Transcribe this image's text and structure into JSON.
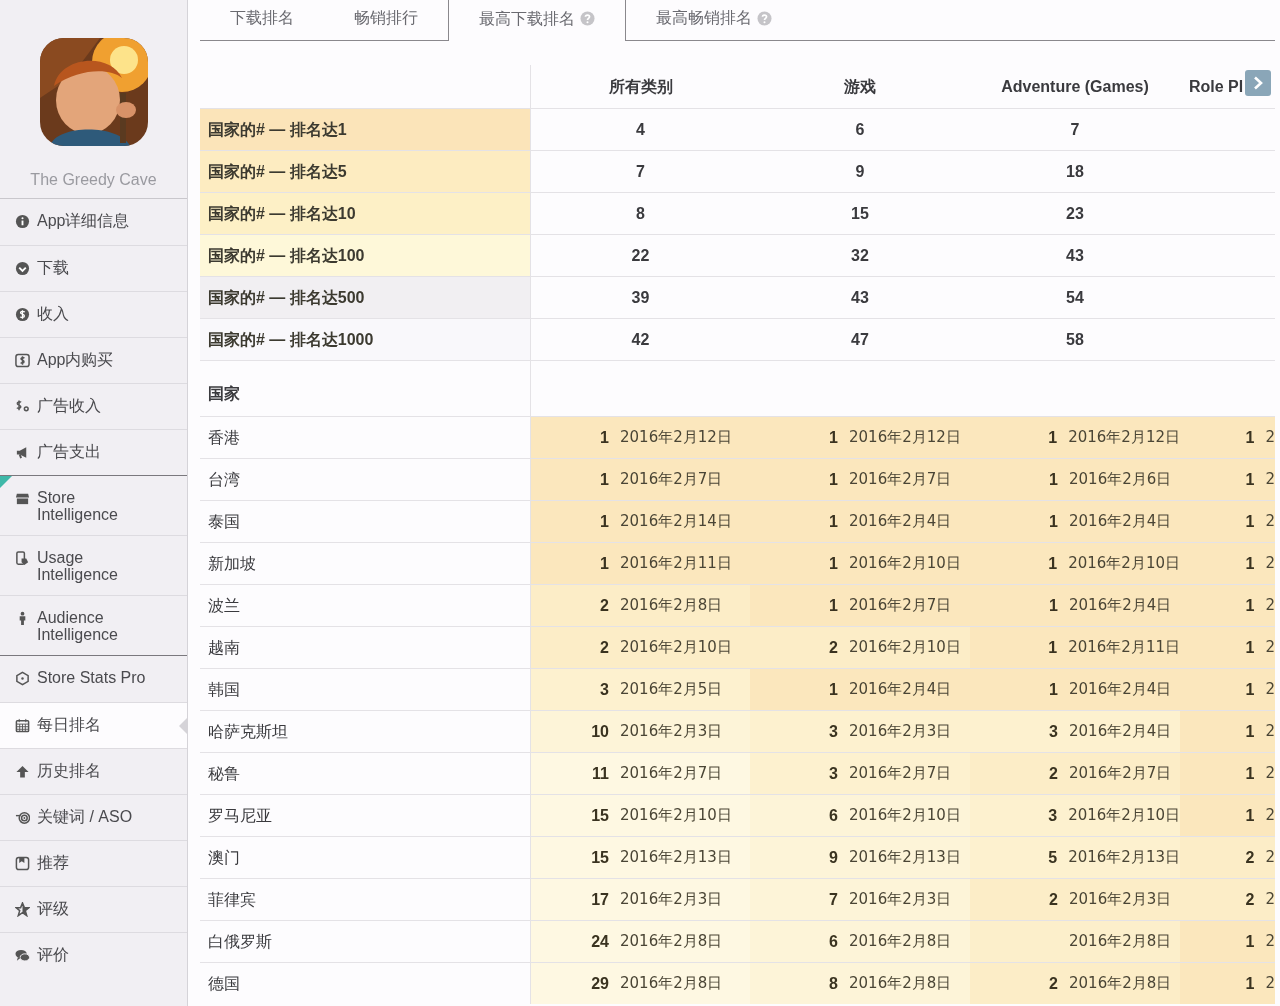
{
  "sidebar": {
    "app": {
      "name": "The Greedy Cave"
    },
    "groups": [
      [
        {
          "label": "App详细信息",
          "selected": false
        },
        {
          "label": "下载",
          "selected": false
        },
        {
          "label": "收入",
          "selected": false
        },
        {
          "label": "App内购买",
          "selected": false
        },
        {
          "label": "广告收入",
          "selected": false
        },
        {
          "label": "广告支出",
          "selected": false
        }
      ],
      [
        {
          "label": "Store Intelligence",
          "selected": false
        },
        {
          "label": "Usage Intelligence",
          "selected": false
        },
        {
          "label": "Audience Intelligence",
          "selected": false
        }
      ],
      [
        {
          "label": "Store Stats Pro",
          "selected": false
        },
        {
          "label": "每日排名",
          "selected": true
        },
        {
          "label": "历史排名",
          "selected": false
        },
        {
          "label": "关键词 / ASO",
          "selected": false
        },
        {
          "label": "推荐",
          "selected": false
        },
        {
          "label": "评级",
          "selected": false
        },
        {
          "label": "评价",
          "selected": false
        }
      ]
    ]
  },
  "tabs": [
    {
      "label": "下载排名",
      "selected": false,
      "help": false
    },
    {
      "label": "畅销排行",
      "selected": false,
      "help": false
    },
    {
      "label": "最高下载排名",
      "selected": true,
      "help": true
    },
    {
      "label": "最高畅销排名",
      "selected": false,
      "help": true
    }
  ],
  "table": {
    "columns": [
      "所有类别",
      "游戏",
      "Adventure (Games)",
      "Role Pl"
    ],
    "summary_rows": [
      {
        "label": "国家的# — 排名达1",
        "color": "#fbe4b9",
        "values": [
          "4",
          "6",
          "7"
        ]
      },
      {
        "label": "国家的# — 排名达5",
        "color": "#fdecc1",
        "values": [
          "7",
          "9",
          "18"
        ]
      },
      {
        "label": "国家的# — 排名达10",
        "color": "#fdf0c6",
        "values": [
          "8",
          "15",
          "23"
        ]
      },
      {
        "label": "国家的# — 排名达100",
        "color": "#fef8d9",
        "values": [
          "22",
          "32",
          "43"
        ]
      },
      {
        "label": "国家的# — 排名达500",
        "color": "#f1eff2",
        "values": [
          "39",
          "43",
          "54"
        ]
      },
      {
        "label": "国家的# — 排名达1000",
        "color": "#f9f8fb",
        "values": [
          "42",
          "47",
          "58"
        ]
      }
    ],
    "section_title": "国家",
    "country_rows": [
      {
        "country": "香港",
        "cells": [
          {
            "rank": "1",
            "date": "2016年2月12日"
          },
          {
            "rank": "1",
            "date": "2016年2月12日"
          },
          {
            "rank": "1",
            "date": "2016年2月12日"
          },
          {
            "rank": "1",
            "date": "2"
          }
        ]
      },
      {
        "country": "台湾",
        "cells": [
          {
            "rank": "1",
            "date": "2016年2月7日"
          },
          {
            "rank": "1",
            "date": "2016年2月7日"
          },
          {
            "rank": "1",
            "date": "2016年2月6日"
          },
          {
            "rank": "1",
            "date": "2"
          }
        ]
      },
      {
        "country": "泰国",
        "cells": [
          {
            "rank": "1",
            "date": "2016年2月14日"
          },
          {
            "rank": "1",
            "date": "2016年2月4日"
          },
          {
            "rank": "1",
            "date": "2016年2月4日"
          },
          {
            "rank": "1",
            "date": "2"
          }
        ]
      },
      {
        "country": "新加坡",
        "cells": [
          {
            "rank": "1",
            "date": "2016年2月11日"
          },
          {
            "rank": "1",
            "date": "2016年2月10日"
          },
          {
            "rank": "1",
            "date": "2016年2月10日"
          },
          {
            "rank": "1",
            "date": "2"
          }
        ]
      },
      {
        "country": "波兰",
        "cells": [
          {
            "rank": "2",
            "date": "2016年2月8日"
          },
          {
            "rank": "1",
            "date": "2016年2月7日"
          },
          {
            "rank": "1",
            "date": "2016年2月4日"
          },
          {
            "rank": "1",
            "date": "2"
          }
        ]
      },
      {
        "country": "越南",
        "cells": [
          {
            "rank": "2",
            "date": "2016年2月10日"
          },
          {
            "rank": "2",
            "date": "2016年2月10日"
          },
          {
            "rank": "1",
            "date": "2016年2月11日"
          },
          {
            "rank": "1",
            "date": "2"
          }
        ]
      },
      {
        "country": "韩国",
        "cells": [
          {
            "rank": "3",
            "date": "2016年2月5日"
          },
          {
            "rank": "1",
            "date": "2016年2月4日"
          },
          {
            "rank": "1",
            "date": "2016年2月4日"
          },
          {
            "rank": "1",
            "date": "2"
          }
        ]
      },
      {
        "country": "哈萨克斯坦",
        "cells": [
          {
            "rank": "10",
            "date": "2016年2月3日"
          },
          {
            "rank": "3",
            "date": "2016年2月3日"
          },
          {
            "rank": "3",
            "date": "2016年2月4日"
          },
          {
            "rank": "1",
            "date": "2"
          }
        ]
      },
      {
        "country": "秘鲁",
        "cells": [
          {
            "rank": "11",
            "date": "2016年2月7日"
          },
          {
            "rank": "3",
            "date": "2016年2月7日"
          },
          {
            "rank": "2",
            "date": "2016年2月7日"
          },
          {
            "rank": "1",
            "date": "2"
          }
        ]
      },
      {
        "country": "罗马尼亚",
        "cells": [
          {
            "rank": "15",
            "date": "2016年2月10日"
          },
          {
            "rank": "6",
            "date": "2016年2月10日"
          },
          {
            "rank": "3",
            "date": "2016年2月10日"
          },
          {
            "rank": "1",
            "date": "2"
          }
        ]
      },
      {
        "country": "澳门",
        "cells": [
          {
            "rank": "15",
            "date": "2016年2月13日"
          },
          {
            "rank": "9",
            "date": "2016年2月13日"
          },
          {
            "rank": "5",
            "date": "2016年2月13日"
          },
          {
            "rank": "2",
            "date": "2"
          }
        ]
      },
      {
        "country": "菲律宾",
        "cells": [
          {
            "rank": "17",
            "date": "2016年2月3日"
          },
          {
            "rank": "7",
            "date": "2016年2月3日"
          },
          {
            "rank": "2",
            "date": "2016年2月3日"
          },
          {
            "rank": "2",
            "date": "2"
          }
        ]
      },
      {
        "country": "白俄罗斯",
        "cells": [
          {
            "rank": "24",
            "date": "2016年2月8日"
          },
          {
            "rank": "6",
            "date": "2016年2月8日"
          },
          {
            "date": "2016年2月8日"
          },
          {
            "rank": "1",
            "date": "2"
          }
        ]
      },
      {
        "country": "德国",
        "cells": [
          {
            "rank": "29",
            "date": "2016年2月8日"
          },
          {
            "rank": "8",
            "date": "2016年2月8日"
          },
          {
            "rank": "2",
            "date": "2016年2月8日"
          },
          {
            "rank": "1",
            "date": "2"
          }
        ]
      }
    ]
  }
}
